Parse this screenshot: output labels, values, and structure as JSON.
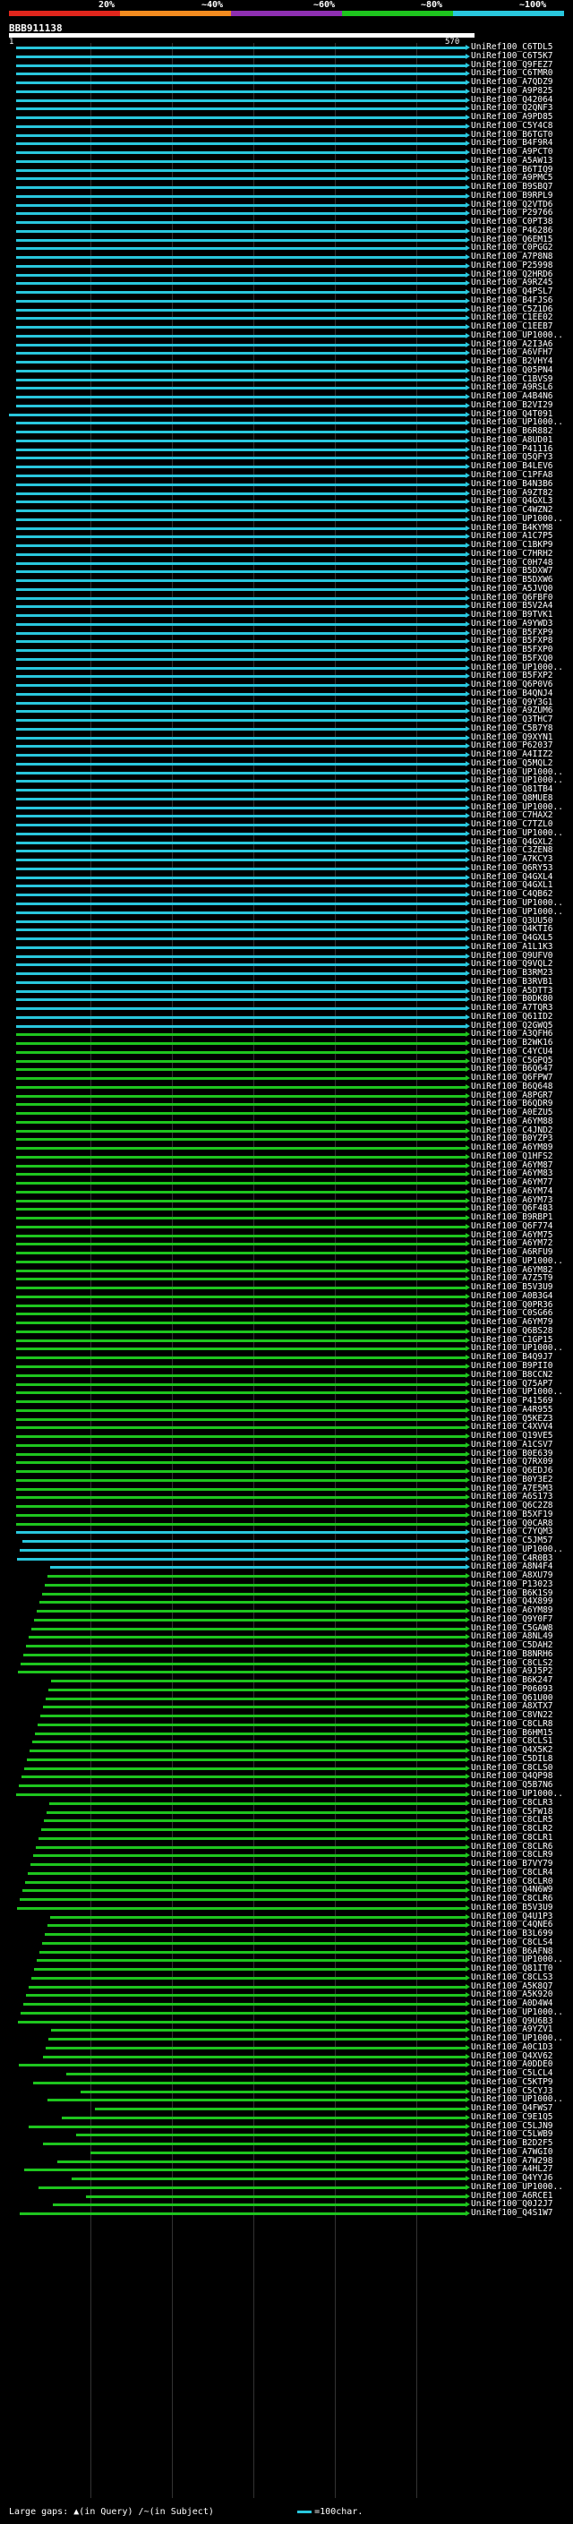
{
  "legend": {
    "ticks": [
      "20%",
      "~40%",
      "~60%",
      "~80%",
      "~100%"
    ],
    "colors": [
      "#e0261c",
      "#f38b1f",
      "#8e2fb1",
      "#1ec51e",
      "#29c7dd"
    ]
  },
  "query": {
    "name": "BBB911138",
    "start": "1",
    "end": "570"
  },
  "hits": {
    "colors": {
      "cyan": "#29c7dd",
      "green": "#1ec51e"
    },
    "labels": [
      "UniRef100_C6TDL5",
      "UniRef100_C6T5K7",
      "UniRef100_Q9FEZ7",
      "UniRef100_C6TMR0",
      "UniRef100_A7QDZ9",
      "UniRef100_A9P825",
      "UniRef100_Q42064",
      "UniRef100_Q2QNF3",
      "UniRef100_A9PD85",
      "UniRef100_C5Y4C8",
      "UniRef100_B6TGT0",
      "UniRef100_B4F9R4",
      "UniRef100_A9PCT0",
      "UniRef100_A5AW13",
      "UniRef100_B6TIQ9",
      "UniRef100_A9PMC5",
      "UniRef100_B9SBQ7",
      "UniRef100_B9RPL9",
      "UniRef100_Q2VTD6",
      "UniRef100_P29766",
      "UniRef100_C0PT38",
      "UniRef100_P46286",
      "UniRef100_Q6EM15",
      "UniRef100_C0PGG2",
      "UniRef100_A7P8N8",
      "UniRef100_P25998",
      "UniRef100_Q2HRD6",
      "UniRef100_A9RZ45",
      "UniRef100_Q4PSL7",
      "UniRef100_B4FJS6",
      "UniRef100_C5Z1D6",
      "UniRef100_C1EE02",
      "UniRef100_C1EEB7",
      "UniRef100_UP1000..",
      "UniRef100_A2I3A6",
      "UniRef100_A6VFH7",
      "UniRef100_B2VHY4",
      "UniRef100_Q05PN4",
      "UniRef100_C1BVS9",
      "UniRef100_A9RSL6",
      "UniRef100_A4B4N6",
      "UniRef100_B2VI29",
      "UniRef100_Q4T091",
      "UniRef100_UP1000..",
      "UniRef100_B6R882",
      "UniRef100_A8UD01",
      "UniRef100_P41116",
      "UniRef100_Q5QFY3",
      "UniRef100_B4LEV6",
      "UniRef100_C1PFA8",
      "UniRef100_B4N3B6",
      "UniRef100_A9ZT82",
      "UniRef100_Q4GXL3",
      "UniRef100_C4WZN2",
      "UniRef100_UP1000..",
      "UniRef100_B4KYM8",
      "UniRef100_A1C7P5",
      "UniRef100_C1BKP9",
      "UniRef100_C7HRH2",
      "UniRef100_C0H748",
      "UniRef100_B5DXW7",
      "UniRef100_B5DXW6",
      "UniRef100_A5JVQ0",
      "UniRef100_Q6FBF0",
      "UniRef100_B5V2A4",
      "UniRef100_B9TVK1",
      "UniRef100_A9YWD3",
      "UniRef100_B5FXP9",
      "UniRef100_B5FXP8",
      "UniRef100_B5FXP0",
      "UniRef100_B5FXQ0",
      "UniRef100_UP1000..",
      "UniRef100_B5FXP2",
      "UniRef100_Q6P0V6",
      "UniRef100_B4QNJ4",
      "UniRef100_Q9Y3G1",
      "UniRef100_A9ZUM6",
      "UniRef100_Q3THC7",
      "UniRef100_C5B7Y8",
      "UniRef100_Q9XYN1",
      "UniRef100_P62037",
      "UniRef100_A4IIZ2",
      "UniRef100_Q5MQL2",
      "UniRef100_UP1000..",
      "UniRef100_UP1000..",
      "UniRef100_Q81TB4",
      "UniRef100_Q8MUE8",
      "UniRef100_UP1000..",
      "UniRef100_C7HAX2",
      "UniRef100_C7TZL0",
      "UniRef100_UP1000..",
      "UniRef100_Q4GXL2",
      "UniRef100_C3ZEN8",
      "UniRef100_A7KCY3",
      "UniRef100_Q6RY53",
      "UniRef100_Q4GXL4",
      "UniRef100_Q4GXL1",
      "UniRef100_C4QB62",
      "UniRef100_UP1000..",
      "UniRef100_UP1000..",
      "UniRef100_Q3UU50",
      "UniRef100_Q4KTI6",
      "UniRef100_Q4GXL5",
      "UniRef100_A1L1K3",
      "UniRef100_Q9UFV0",
      "UniRef100_Q9VQL2",
      "UniRef100_B3RM23",
      "UniRef100_B3RVB1",
      "UniRef100_A5DTT3",
      "UniRef100_B0DK80",
      "UniRef100_A7TQR3",
      "UniRef100_Q61ID2",
      "UniRef100_Q2GWQ5",
      "UniRef100_A3QFH6",
      "UniRef100_B2WK16",
      "UniRef100_C4YCU4",
      "UniRef100_C5GPQ5",
      "UniRef100_B6Q647",
      "UniRef100_Q6FPW7",
      "UniRef100_B6Q648",
      "UniRef100_A8PGR7",
      "UniRef100_B6QDR9",
      "UniRef100_A0EZU5",
      "UniRef100_A6YM88",
      "UniRef100_C4JND2",
      "UniRef100_B0YZP3",
      "UniRef100_A6YM89",
      "UniRef100_Q1HFS2",
      "UniRef100_A6YM87",
      "UniRef100_A6YM83",
      "UniRef100_A6YM77",
      "UniRef100_A6YM74",
      "UniRef100_A6YM73",
      "UniRef100_Q6F483",
      "UniRef100_B9RBP1",
      "UniRef100_Q6F774",
      "UniRef100_A6YM75",
      "UniRef100_A6YM72",
      "UniRef100_A6RFU9",
      "UniRef100_UP1000..",
      "UniRef100_A6YM82",
      "UniRef100_A7Z5T9",
      "UniRef100_B5V3U9",
      "UniRef100_A0B3G4",
      "UniRef100_Q0PR36",
      "UniRef100_C0SG66",
      "UniRef100_A6YM79",
      "UniRef100_Q6BS28",
      "UniRef100_C1GP15",
      "UniRef100_UP1000..",
      "UniRef100_B4Q9J7",
      "UniRef100_B9PII0",
      "UniRef100_B8CCN2",
      "UniRef100_Q75AP7",
      "UniRef100_UP1000..",
      "UniRef100_P41569",
      "UniRef100_A4R955",
      "UniRef100_Q5KEZ3",
      "UniRef100_C4XVV4",
      "UniRef100_Q19VE5",
      "UniRef100_A1CSV7",
      "UniRef100_B0E639",
      "UniRef100_Q7RX09",
      "UniRef100_Q6EDJ6",
      "UniRef100_B0Y3E2",
      "UniRef100_A7E5M3",
      "UniRef100_A6S173",
      "UniRef100_Q6C2Z8",
      "UniRef100_B5XF19",
      "UniRef100_Q0CAR8",
      "UniRef100_C7YQM3",
      "UniRef100_C5JM57",
      "UniRef100_UP1000..",
      "UniRef100_C4R0B3",
      "UniRef100_A8N4F4",
      "UniRef100_A8XU79",
      "UniRef100_P13023",
      "UniRef100_B6K1S9",
      "UniRef100_Q4X899",
      "UniRef100_A6YM89",
      "UniRef100_Q9Y0F7",
      "UniRef100_C5GAW8",
      "UniRef100_A8NL49",
      "UniRef100_C5DAH2",
      "UniRef100_B8NRH6",
      "UniRef100_C8CLS2",
      "UniRef100_A9J5P2",
      "UniRef100_B6K247",
      "UniRef100_P06093",
      "UniRef100_Q61U00",
      "UniRef100_A8XTX7",
      "UniRef100_C8VN22",
      "UniRef100_C8CLR8",
      "UniRef100_B6HM15",
      "UniRef100_C8CLS1",
      "UniRef100_Q4X5K2",
      "UniRef100_C5DIL8",
      "UniRef100_C8CLS0",
      "UniRef100_Q4QP98",
      "UniRef100_Q5B7N6",
      "UniRef100_UP1000..",
      "UniRef100_C8CLR3",
      "UniRef100_C5FW18",
      "UniRef100_C8CLR5",
      "UniRef100_C8CLR2",
      "UniRef100_C8CLR1",
      "UniRef100_C8CLR6",
      "UniRef100_C8CLR9",
      "UniRef100_B7VY79",
      "UniRef100_C8CLR4",
      "UniRef100_C8CLR0",
      "UniRef100_Q4N6W9",
      "UniRef100_C8CLR6",
      "UniRef100_B5V3U9",
      "UniRef100_Q4U1P3",
      "UniRef100_C4QNE6",
      "UniRef100_B3L699",
      "UniRef100_C8CLS4",
      "UniRef100_B6AFN8",
      "UniRef100_UP1000..",
      "UniRef100_Q81IT0",
      "UniRef100_C8CLS3",
      "UniRef100_A5K8Q7",
      "UniRef100_A5K920",
      "UniRef100_A0D4W4",
      "UniRef100_UP1000..",
      "UniRef100_Q9U6B3",
      "UniRef100_A9YZV1",
      "UniRef100_UP1000..",
      "UniRef100_A0C1D3",
      "UniRef100_Q4XV62",
      "UniRef100_A0DDE0",
      "UniRef100_C5LCL4",
      "UniRef100_C5KTP9",
      "UniRef100_C5CYJ3",
      "UniRef100_UP1000..",
      "UniRef100_Q4FWS7",
      "UniRef100_C9E1Q5",
      "UniRef100_C5LJN9",
      "UniRef100_C5LWB9",
      "UniRef100_B2D2F5",
      "UniRef100_A7WGI0",
      "UniRef100_A7W298",
      "UniRef100_A4HL27",
      "UniRef100_Q4YYJ6",
      "UniRef100_UP1000..",
      "UniRef100_A6RCE1",
      "UniRef100_Q0J2J7",
      "UniRef100_Q4S1W7"
    ]
  },
  "footer": {
    "large_gaps_label": "Large gaps:",
    "in_query": "(in Query)",
    "in_subject": "(in Subject)",
    "scale_label": "=100char."
  }
}
